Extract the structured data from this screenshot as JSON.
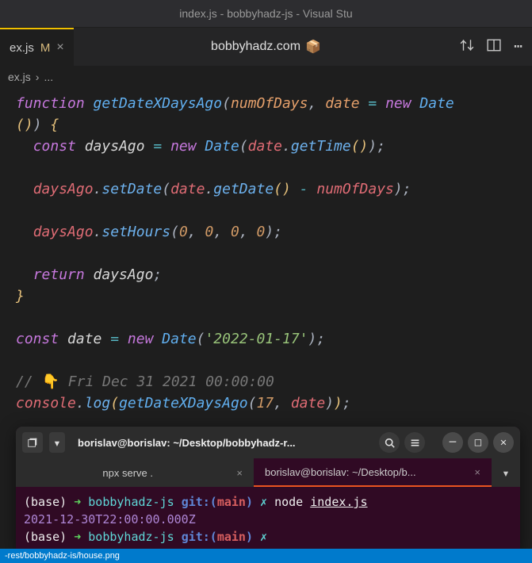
{
  "window_title": "index.js - bobbyhadz-js - Visual Stu",
  "tab": {
    "name": "ex.js",
    "modified": "M"
  },
  "center_title": "bobbyhadz.com",
  "center_emoji": "📦",
  "breadcrumb": {
    "file": "ex.js",
    "sep": "›",
    "more": "..."
  },
  "code": {
    "l1": {
      "kw": "function ",
      "fn": "getDateXDaysAgo",
      "open": "(",
      "p1": "numOfDays",
      "c": ", ",
      "p2": "date",
      "eq": " = ",
      "new": "new ",
      "cls": "Date"
    },
    "l2": {
      "open": "()",
      "close": ")",
      "brace": " {"
    },
    "l3": {
      "indent": "  ",
      "kw": "const ",
      "v": "daysAgo",
      "eq": " = ",
      "new": "new ",
      "cls": "Date",
      "o": "(",
      "obj": "date",
      "dot": ".",
      "m": "getTime",
      "p": "()",
      "c": ")",
      "s": ";"
    },
    "l4": {
      "indent": "  ",
      "obj": "daysAgo",
      "d1": ".",
      "m1": "setDate",
      "o1": "(",
      "obj2": "date",
      "d2": ".",
      "m2": "getDate",
      "p1": "()",
      "op": " - ",
      "v": "numOfDays",
      "c": ")",
      "s": ";"
    },
    "l5": {
      "indent": "  ",
      "obj": "daysAgo",
      "d": ".",
      "m": "setHours",
      "o": "(",
      "n1": "0",
      "c1": ", ",
      "n2": "0",
      "c2": ", ",
      "n3": "0",
      "c3": ", ",
      "n4": "0",
      "cl": ")",
      "s": ";"
    },
    "l6": {
      "indent": "  ",
      "kw": "return ",
      "v": "daysAgo",
      "s": ";"
    },
    "l7": {
      "brace": "}"
    },
    "l8": {
      "kw": "const ",
      "v": "date",
      "eq": " = ",
      "new": "new ",
      "cls": "Date",
      "o": "(",
      "str": "'2022-01-17'",
      "c": ")",
      "s": ";"
    },
    "l9": {
      "c": "// ",
      "emoji": "👇",
      "txt": " Fri Dec 31 2021 00:00:00"
    },
    "l10": {
      "obj": "console",
      "d": ".",
      "m": "log",
      "o1": "(",
      "fn": "getDateXDaysAgo",
      "o2": "(",
      "n": "17",
      "c1": ", ",
      "v": "date",
      "c2": ")",
      "c3": ")",
      "s": ";"
    }
  },
  "terminal": {
    "title": "borislav@borislav: ~/Desktop/bobbyhadz-r...",
    "tab1": "npx serve .",
    "tab2": "borislav@borislav: ~/Desktop/b...",
    "line1": {
      "base": "(base) ",
      "arrow": "➜  ",
      "dir": "bobbyhadz-js ",
      "git": "git:(",
      "branch": "main",
      "close": ") ",
      "x": "✗ ",
      "cmd": "node ",
      "file": "index.js"
    },
    "line2": "2021-12-30T22:00:00.000Z",
    "line3": {
      "base": "(base) ",
      "arrow": "➜  ",
      "dir": "bobbyhadz-js ",
      "git": "git:(",
      "branch": "main",
      "close": ") ",
      "x": "✗ "
    }
  },
  "status": "-rest/bobbyhadz-is/house.png"
}
